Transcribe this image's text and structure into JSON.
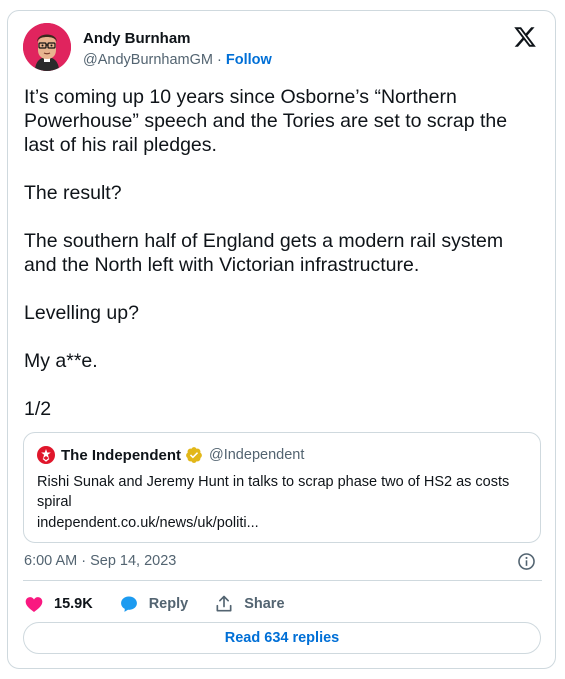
{
  "author": {
    "name": "Andy Burnham",
    "handle": "@AndyBurnhamGM",
    "separator": "·",
    "follow_label": "Follow"
  },
  "tweet": {
    "paragraphs": [
      "It’s coming up 10 years since Osborne’s “Northern Powerhouse” speech and the Tories are set to scrap the last of his rail pledges.",
      "The result?",
      "The southern half of England gets a modern rail system and the North left with Victorian infrastructure.",
      "Levelling up?",
      "My a**e.",
      "1/2"
    ]
  },
  "quote": {
    "name": "The Independent",
    "handle": "@Independent",
    "body": "Rishi Sunak and Jeremy Hunt in talks to scrap phase two of HS2 as costs spiral",
    "link": "independent.co.uk/news/uk/politi..."
  },
  "timestamp": "6:00 AM · Sep 14, 2023",
  "actions": {
    "like_count": "15.9K",
    "reply_label": "Reply",
    "share_label": "Share"
  },
  "read_replies_label": "Read 634 replies",
  "colors": {
    "accent": "#006fd6",
    "like": "#f91880",
    "reply": "#1d9bf0",
    "verified": "#e2b719",
    "independent_red": "#e0162b"
  },
  "icons": [
    "x-logo-icon",
    "info-icon",
    "heart-icon",
    "reply-bubble-icon",
    "share-icon",
    "verified-badge-icon",
    "independent-logo-icon"
  ]
}
